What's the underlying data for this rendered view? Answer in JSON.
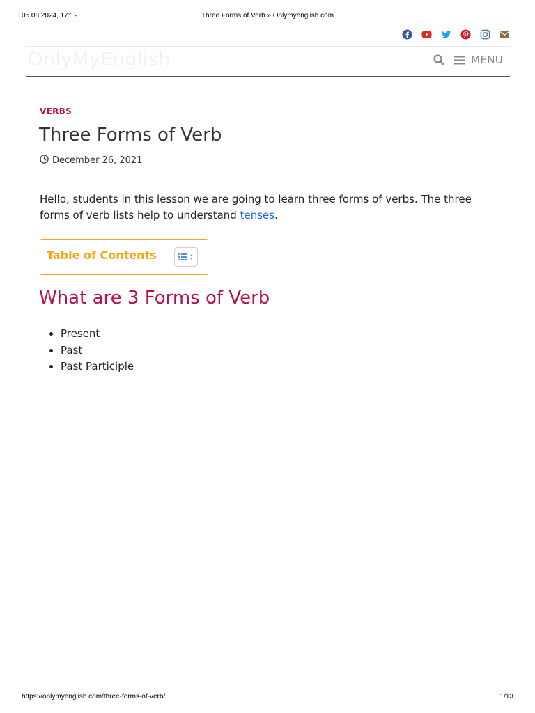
{
  "print_header": {
    "datetime": "05.08.2024, 17:12",
    "page_title": "Three Forms of Verb » Onlymyenglish.com"
  },
  "print_footer": {
    "url": "https://onlymyenglish.com/three-forms-of-verb/",
    "page_number": "1/13"
  },
  "social_icons": [
    {
      "name": "facebook-icon",
      "color": "#3b5998"
    },
    {
      "name": "youtube-icon",
      "color": "#e02a20"
    },
    {
      "name": "twitter-icon",
      "color": "#1da1f2"
    },
    {
      "name": "pinterest-icon",
      "color": "#cb2027"
    },
    {
      "name": "instagram-icon",
      "color": "#517fa4"
    },
    {
      "name": "email-icon",
      "color": "#8b6d3f"
    }
  ],
  "header": {
    "logo_text": "OnlyMyEnglish",
    "menu_label": "MENU"
  },
  "article": {
    "category": "VERBS",
    "title": "Three Forms of Verb",
    "date": "December 26, 2021",
    "intro_text": "Hello, students in this lesson we are going to learn three forms of verbs. The three forms of verb lists help to understand ",
    "intro_link": "tenses",
    "intro_end": ".",
    "toc_title": "Table of Contents",
    "section_heading": "What are 3 Forms of Verb",
    "forms": [
      "Present",
      "Past",
      "Past Participle"
    ]
  },
  "colors": {
    "accent": "#b5134a",
    "toc": "#f7a51c",
    "link": "#1b6ad6"
  }
}
